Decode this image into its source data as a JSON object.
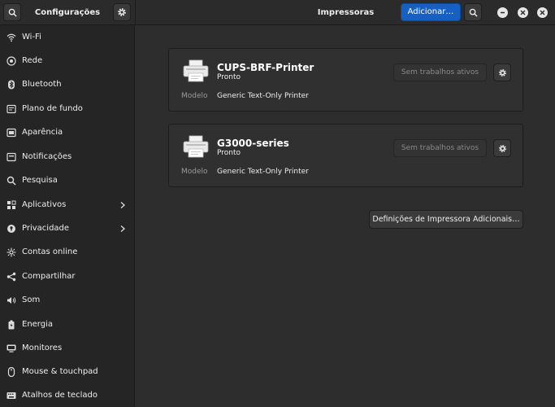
{
  "sidebar": {
    "title": "Configurações",
    "items": [
      {
        "label": "Wi-Fi",
        "icon": "wifi-icon"
      },
      {
        "label": "Rede",
        "icon": "network-icon"
      },
      {
        "label": "Bluetooth",
        "icon": "bluetooth-icon"
      },
      {
        "label": "Plano de fundo",
        "icon": "background-icon"
      },
      {
        "label": "Aparência",
        "icon": "appearance-icon"
      },
      {
        "label": "Notificações",
        "icon": "notifications-icon"
      },
      {
        "label": "Pesquisa",
        "icon": "search-icon"
      },
      {
        "label": "Aplicativos",
        "icon": "apps-icon",
        "has_submenu": true
      },
      {
        "label": "Privacidade",
        "icon": "privacy-icon",
        "has_submenu": true
      },
      {
        "label": "Contas online",
        "icon": "online-accounts-icon"
      },
      {
        "label": "Compartilhar",
        "icon": "share-icon"
      },
      {
        "label": "Som",
        "icon": "sound-icon"
      },
      {
        "label": "Energia",
        "icon": "power-icon"
      },
      {
        "label": "Monitores",
        "icon": "displays-icon"
      },
      {
        "label": "Mouse & touchpad",
        "icon": "mouse-icon"
      },
      {
        "label": "Atalhos de teclado",
        "icon": "keyboard-icon"
      }
    ]
  },
  "header": {
    "title": "Impressoras",
    "add_label": "Adicionar…"
  },
  "printers": [
    {
      "name": "CUPS-BRF-Printer",
      "status": "Pronto",
      "model_key": "Modelo",
      "model": "Generic Text-Only Printer",
      "jobs_label": "Sem trabalhos ativos"
    },
    {
      "name": "G3000-series",
      "status": "Pronto",
      "model_key": "Modelo",
      "model": "Generic Text-Only Printer",
      "jobs_label": "Sem trabalhos ativos"
    }
  ],
  "additional_settings_label": "Definições de Impressora Adicionais…",
  "colors": {
    "accent": "#1660c4",
    "sidebar_bg": "#252525",
    "main_bg": "#2d2d2d"
  }
}
